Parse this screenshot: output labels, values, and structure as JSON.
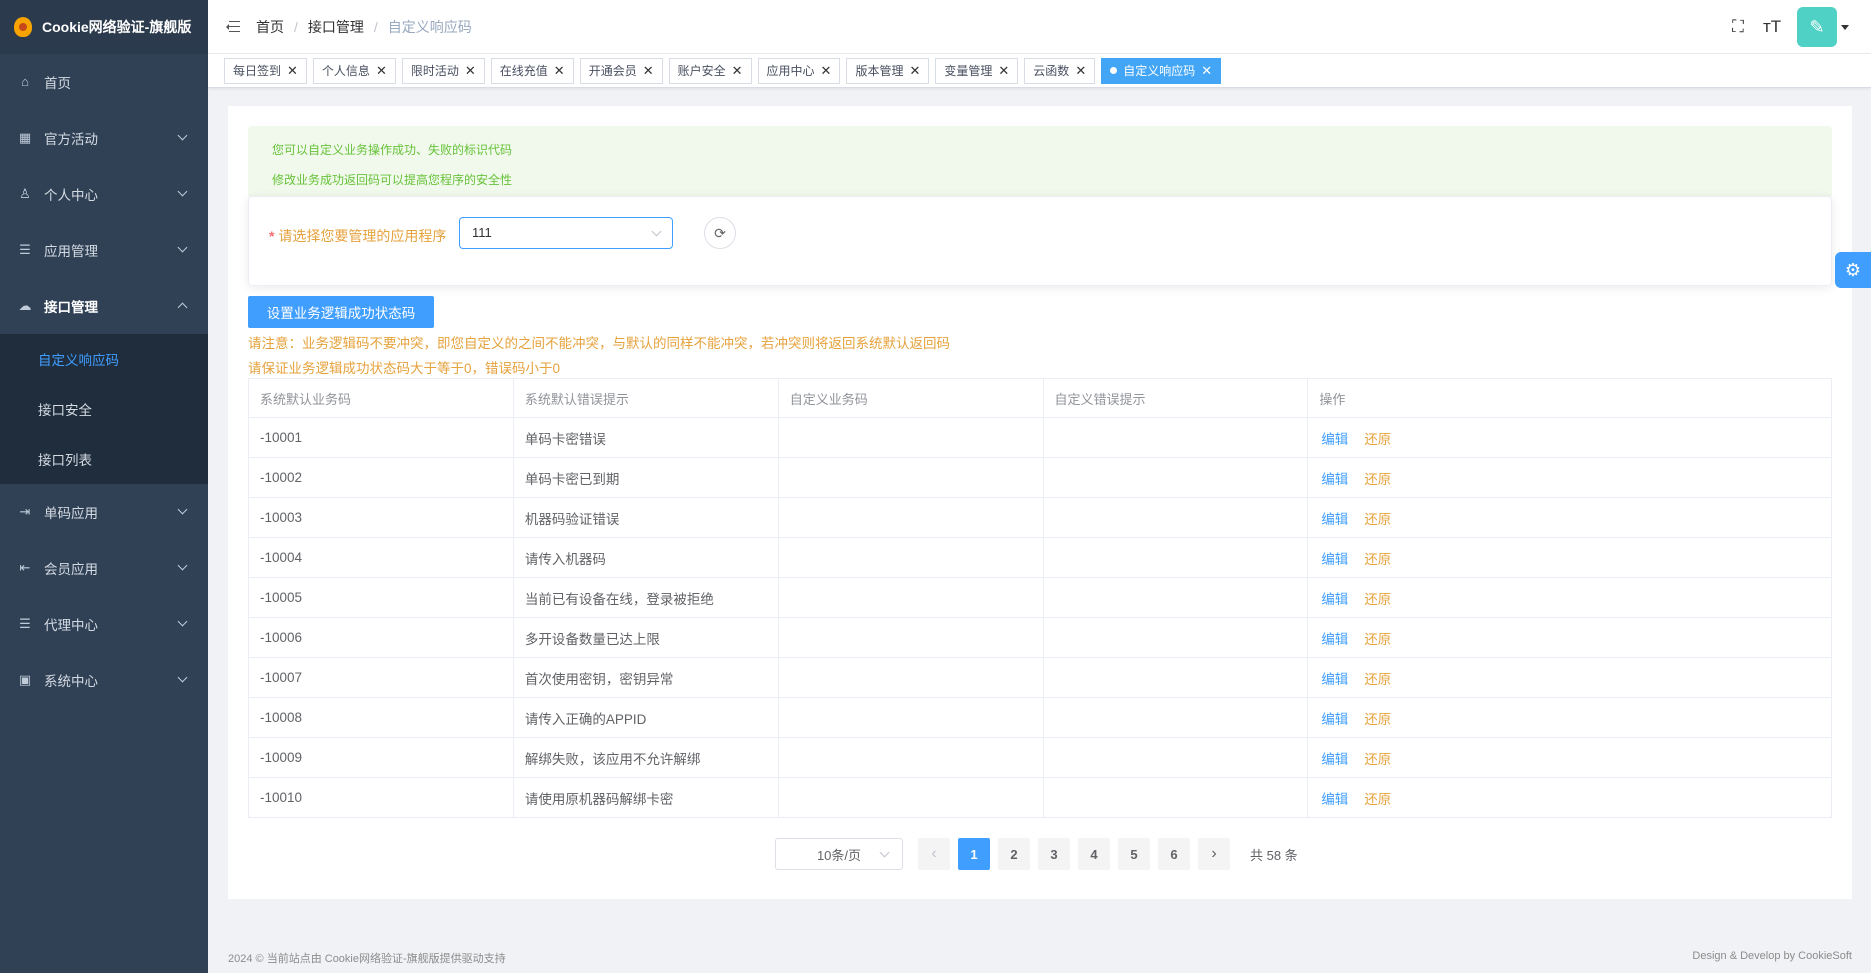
{
  "app": {
    "title": "Cookie网络验证-旗舰版"
  },
  "sidebar": {
    "items": [
      {
        "label": "首页",
        "icon": "home-icon"
      },
      {
        "label": "官方活动",
        "icon": "grid-icon"
      },
      {
        "label": "个人中心",
        "icon": "user-icon"
      },
      {
        "label": "应用管理",
        "icon": "list-tree-icon"
      },
      {
        "label": "接口管理",
        "icon": "cloud-icon"
      },
      {
        "label": "单码应用",
        "icon": "login-arrow-icon"
      },
      {
        "label": "会员应用",
        "icon": "logout-arrow-icon"
      },
      {
        "label": "代理中心",
        "icon": "list-tree-icon"
      },
      {
        "label": "系统中心",
        "icon": "monitor-icon"
      }
    ],
    "submenu": [
      "自定义响应码",
      "接口安全",
      "接口列表"
    ]
  },
  "breadcrumb": [
    "首页",
    "接口管理",
    "自定义响应码"
  ],
  "tags": [
    "每日签到",
    "个人信息",
    "限时活动",
    "在线充值",
    "开通会员",
    "账户安全",
    "应用中心",
    "版本管理",
    "变量管理",
    "云函数",
    "自定义响应码"
  ],
  "alert": {
    "line1": "您可以自定义业务操作成功、失败的标识代码",
    "line2": "修改业务成功返回码可以提高您程序的安全性"
  },
  "form": {
    "required_mark": "*",
    "label": "请选择您要管理的应用程序",
    "selected_app": "111"
  },
  "actions": {
    "set_success_code": "设置业务逻辑成功状态码"
  },
  "notices": {
    "n1": "请注意：业务逻辑码不要冲突，即您自定义的之间不能冲突，与默认的同样不能冲突，若冲突则将返回系统默认返回码",
    "n2": "请保证业务逻辑成功状态码大于等于0，错误码小于0"
  },
  "table": {
    "headers": [
      "系统默认业务码",
      "系统默认错误提示",
      "自定义业务码",
      "自定义错误提示",
      "操作"
    ],
    "edit_label": "编辑",
    "restore_label": "还原",
    "rows": [
      {
        "code": "-10001",
        "msg": "单码卡密错误",
        "custom_code": "",
        "custom_msg": ""
      },
      {
        "code": "-10002",
        "msg": "单码卡密已到期",
        "custom_code": "",
        "custom_msg": ""
      },
      {
        "code": "-10003",
        "msg": "机器码验证错误",
        "custom_code": "",
        "custom_msg": ""
      },
      {
        "code": "-10004",
        "msg": "请传入机器码",
        "custom_code": "",
        "custom_msg": ""
      },
      {
        "code": "-10005",
        "msg": "当前已有设备在线，登录被拒绝",
        "custom_code": "",
        "custom_msg": ""
      },
      {
        "code": "-10006",
        "msg": "多开设备数量已达上限",
        "custom_code": "",
        "custom_msg": ""
      },
      {
        "code": "-10007",
        "msg": "首次使用密钥，密钥异常",
        "custom_code": "",
        "custom_msg": ""
      },
      {
        "code": "-10008",
        "msg": "请传入正确的APPID",
        "custom_code": "",
        "custom_msg": ""
      },
      {
        "code": "-10009",
        "msg": "解绑失败，该应用不允许解绑",
        "custom_code": "",
        "custom_msg": ""
      },
      {
        "code": "-10010",
        "msg": "请使用原机器码解绑卡密",
        "custom_code": "",
        "custom_msg": ""
      }
    ]
  },
  "pagination": {
    "page_size": "10条/页",
    "pages": [
      "1",
      "2",
      "3",
      "4",
      "5",
      "6"
    ],
    "current": "1",
    "total": "共 58 条"
  },
  "footer": {
    "left": "2024 © 当前站点由 Cookie网络验证-旗舰版提供驱动支持",
    "right": "Design & Develop by CookieSoft"
  },
  "colors": {
    "primary": "#409eff",
    "sidebar_bg": "#304156",
    "warning": "#e6a23c",
    "success": "#67c23a"
  }
}
